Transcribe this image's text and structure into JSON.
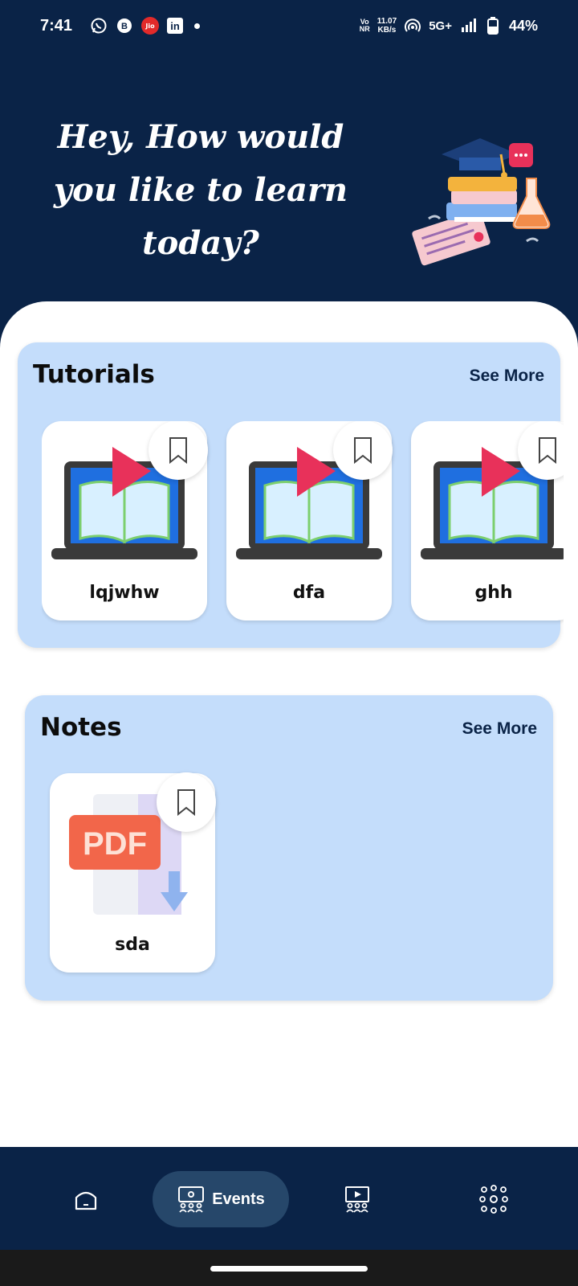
{
  "status_bar": {
    "time": "7:41",
    "volte_top": "Vo",
    "volte_bottom": "NR",
    "net_speed_value": "11.07",
    "net_speed_unit": "KB/s",
    "network": "5G+",
    "battery": "44%",
    "notification_icons": [
      "whatsapp-icon",
      "whatsapp-business-icon",
      "jio-icon",
      "linkedin-icon"
    ],
    "jio_label": "Jio",
    "linkedin_label": "in"
  },
  "hero": {
    "title_line1": "Hey, How would",
    "title_line2": "you like to learn",
    "title_line3": "today?"
  },
  "tutorials": {
    "title": "Tutorials",
    "see_more": "See More",
    "items": [
      {
        "label": "lqjwhw"
      },
      {
        "label": "dfa"
      },
      {
        "label": "ghh"
      }
    ]
  },
  "notes": {
    "title": "Notes",
    "see_more": "See More",
    "items": [
      {
        "label": "sda",
        "thumb_text": "PDF"
      }
    ]
  },
  "bottom_nav": {
    "items": [
      {
        "icon": "home-icon",
        "label": ""
      },
      {
        "icon": "events-icon",
        "label": "Events",
        "active": true
      },
      {
        "icon": "classroom-icon",
        "label": ""
      },
      {
        "icon": "network-icon",
        "label": ""
      }
    ]
  },
  "colors": {
    "primary_dark": "#0a2347",
    "card_bg": "#c4ddfb",
    "active_nav": "#26476a",
    "play_red": "#e8315a",
    "pdf_orange": "#f2664a"
  }
}
